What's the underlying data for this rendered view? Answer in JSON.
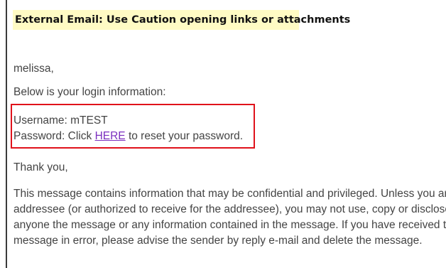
{
  "banner": {
    "text": "External Email: Use Caution opening links or attachments",
    "background": "#fffbc4"
  },
  "email": {
    "greeting": "melissa,",
    "intro": "Below is your login information:",
    "username_line": "Username: mTEST",
    "password_prefix": "Password: Click ",
    "reset_link_label": "HERE",
    "password_suffix": " to reset your password.",
    "sign_off": "Thank you,",
    "disclaimer_lines": [
      "This message contains information that may be confidential and privileged. Unless you are t",
      "addressee (or authorized to receive for the addressee), you may not use, copy or disclose to",
      "anyone the message or any information contained in the message. If you have received the",
      "message in error, please advise the sender by reply e-mail and delete the message."
    ]
  },
  "colors": {
    "highlight_box": "#e0121b",
    "link": "#7b2fbf",
    "body_text": "#444444"
  }
}
